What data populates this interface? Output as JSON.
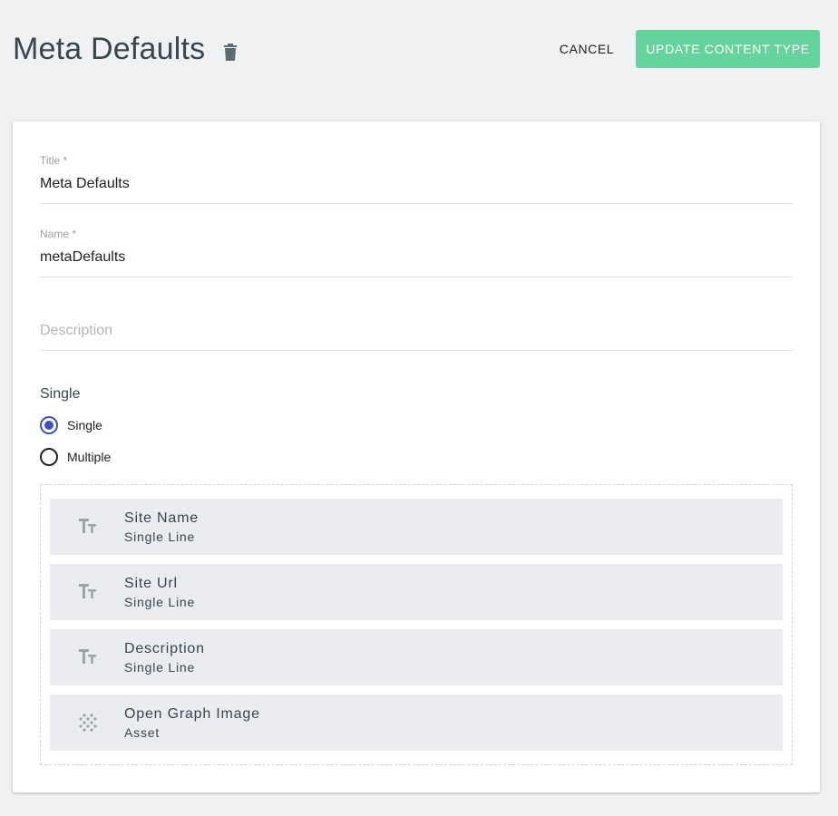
{
  "header": {
    "title": "Meta Defaults",
    "cancel_label": "CANCEL",
    "update_label": "UPDATE CONTENT TYPE",
    "accent_color": "#66d39c"
  },
  "form": {
    "title_field": {
      "label": "Title *",
      "value": "Meta Defaults"
    },
    "name_field": {
      "label": "Name *",
      "value": "metaDefaults"
    },
    "description_field": {
      "placeholder": "Description",
      "value": ""
    },
    "mode": {
      "label": "Single",
      "options": [
        {
          "label": "Single",
          "selected": true
        },
        {
          "label": "Multiple",
          "selected": false
        }
      ]
    }
  },
  "fields": [
    {
      "name": "Site Name",
      "type": "Single Line",
      "icon": "text-type-icon"
    },
    {
      "name": "Site Url",
      "type": "Single Line",
      "icon": "text-type-icon"
    },
    {
      "name": "Description",
      "type": "Single Line",
      "icon": "text-type-icon"
    },
    {
      "name": "Open Graph Image",
      "type": "Asset",
      "icon": "asset-dots-icon"
    }
  ]
}
